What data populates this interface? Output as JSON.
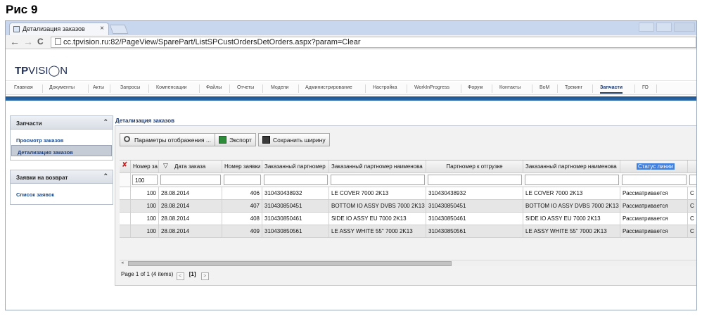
{
  "figure_caption": "Рис 9",
  "browser": {
    "tab_title": "Детализация заказов",
    "tab_close": "×",
    "url": "cc.tpvision.ru:82/PageView/SparePart/ListSPCustOrdersDetOrders.aspx?param=Clear",
    "nav": {
      "back": "←",
      "forward": "→",
      "reload": "C"
    }
  },
  "site": {
    "logo_bold": "TP",
    "logo_light": "VISI◯N",
    "menu": [
      "Главная",
      "Документы",
      "Акты",
      "Запросы",
      "Компенсации",
      "Файлы",
      "Отчеты",
      "Модели",
      "Администрирование",
      "Настройка",
      "WorkInProgress",
      "Форум",
      "Контакты",
      "BoM",
      "Трекинг",
      "Запчасти",
      "ГО"
    ],
    "menu_active": "Запчасти"
  },
  "sidebar": {
    "panels": [
      {
        "title": "Запчасти",
        "chevron": "⌃",
        "items": [
          {
            "label": "Просмотр заказов",
            "selected": false
          },
          {
            "label": "Детализация заказов",
            "selected": true
          }
        ]
      },
      {
        "title": "Заявки на возврат",
        "chevron": "⌃",
        "items": [
          {
            "label": "Список заявок",
            "selected": false
          }
        ]
      }
    ]
  },
  "content": {
    "title": "Детализация заказов",
    "toolbar": {
      "params_label": "Параметры отображения ...",
      "export_label": "Экспорт",
      "save_width_label": "Сохранить ширину"
    },
    "grid": {
      "columns": [
        "Номер за",
        "Дата заказа",
        "Номер заявки",
        "Заказанный партномер",
        "Заказанный партномер наименова",
        "Партномер к отгрузке",
        "Заказанный партномер наименова",
        "Статус линии"
      ],
      "filter_value": "100",
      "rows": [
        [
          "100",
          "28.08.2014",
          "406",
          "310430438932",
          "LE COVER 7000 2K13",
          "310430438932",
          "LE COVER 7000 2K13",
          "Рассматривается",
          "С"
        ],
        [
          "100",
          "28.08.2014",
          "407",
          "310430850451",
          "BOTTOM IO ASSY DVBS 7000 2K13",
          "310430850451",
          "BOTTOM IO ASSY DVBS 7000 2K13",
          "Рассматривается",
          "С"
        ],
        [
          "100",
          "28.08.2014",
          "408",
          "310430850461",
          "SIDE IO ASSY EU 7000 2K13",
          "310430850461",
          "SIDE IO ASSY EU 7000 2K13",
          "Рассматривается",
          "С"
        ],
        [
          "100",
          "28.08.2014",
          "409",
          "310430850561",
          "LE ASSY WHITE 55\" 7000 2K13",
          "310430850561",
          "LE ASSY WHITE 55\" 7000 2K13",
          "Рассматривается",
          "С"
        ]
      ]
    },
    "pager": {
      "summary": "Page 1 of 1 (4 items)",
      "prev": "<",
      "current": "[1]",
      "next": ">"
    }
  }
}
